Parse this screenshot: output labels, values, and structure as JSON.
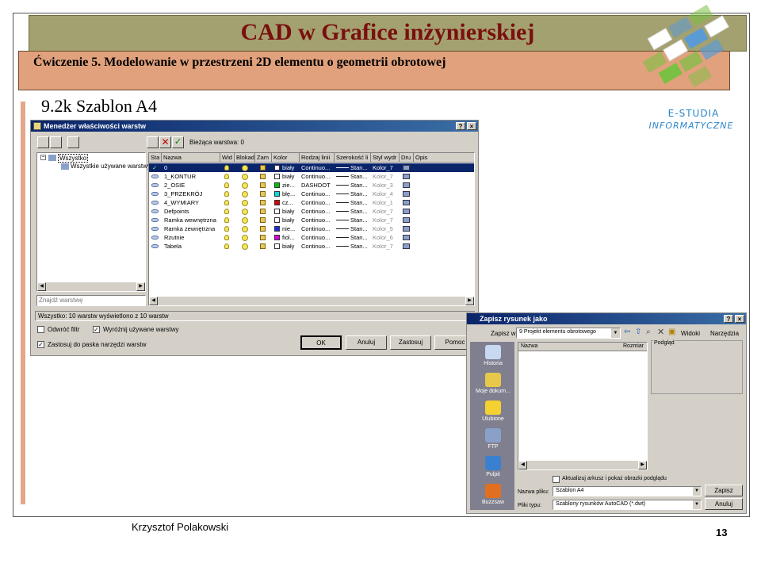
{
  "slide": {
    "title": "CAD w Grafice inżynierskiej",
    "subtitle": "Ćwiczenie 5. Modelowanie w przestrzeni 2D elementu o geometrii obrotowej",
    "section": "9.2k Szablon A4",
    "author": "Krzysztof Polakowski",
    "page_number": "13",
    "logo": {
      "line1": "E-STUDIA",
      "line2": "INFORMATYCZNE",
      "colors": [
        "#5b9bd5",
        "#7ac143",
        "#ffffff"
      ]
    },
    "colors": {
      "title_band": "#a3a16f",
      "subtitle_band": "#e0a17c",
      "title_text": "#7a0f0f",
      "accent_bar": "#e3a78a"
    }
  },
  "layer_manager": {
    "title": "Menedżer właściwości warstw",
    "help_btn": "?",
    "close_btn": "×",
    "current_layer": "Bieżąca warstwa: 0",
    "tree": {
      "root": "Wszystko",
      "child": "Wszystkie używane warstwy"
    },
    "search_placeholder": "Znajdź warstwę",
    "columns": [
      "Sta",
      "Nazwa",
      "Wid",
      "Blokad",
      "Zam",
      "Kolor",
      "Rodzaj linii",
      "Szerokość li",
      "Styl wydr",
      "Dru",
      "Opis"
    ],
    "rows": [
      {
        "name": "0",
        "color_name": "biały",
        "color": "#ffffff",
        "linetype": "Continuo...",
        "lineweight": "Stan...",
        "plotstyle": "Kolor_7",
        "selected": true
      },
      {
        "name": "1_KONTUR",
        "color_name": "biały",
        "color": "#ffffff",
        "linetype": "Continuo...",
        "lineweight": "Stan...",
        "plotstyle": "Kolor_7"
      },
      {
        "name": "2_OSIE",
        "color_name": "zie...",
        "color": "#00c000",
        "linetype": "DASHDOT",
        "lineweight": "Stan...",
        "plotstyle": "Kolor_3"
      },
      {
        "name": "3_PRZEKRÓJ",
        "color_name": "błę...",
        "color": "#00e0e0",
        "linetype": "Continuo...",
        "lineweight": "Stan...",
        "plotstyle": "Kolor_4"
      },
      {
        "name": "4_WYMIARY",
        "color_name": "cz...",
        "color": "#e00000",
        "linetype": "Continuo...",
        "lineweight": "Stan...",
        "plotstyle": "Kolor_1"
      },
      {
        "name": "Defpoints",
        "color_name": "biały",
        "color": "#ffffff",
        "linetype": "Continuo...",
        "lineweight": "Stan...",
        "plotstyle": "Kolor_7"
      },
      {
        "name": "Ramka wewnętrzna",
        "color_name": "biały",
        "color": "#ffffff",
        "linetype": "Continuo...",
        "lineweight": "Stan...",
        "plotstyle": "Kolor_7"
      },
      {
        "name": "Ramka zewnętrzna",
        "color_name": "nie...",
        "color": "#1030e0",
        "linetype": "Continuo...",
        "lineweight": "Stan...",
        "plotstyle": "Kolor_5"
      },
      {
        "name": "Rzutnie",
        "color_name": "fiol...",
        "color": "#e000e0",
        "linetype": "Continuo...",
        "lineweight": "Stan...",
        "plotstyle": "Kolor_6"
      },
      {
        "name": "Tabela",
        "color_name": "biały",
        "color": "#ffffff",
        "linetype": "Continuo...",
        "lineweight": "Stan...",
        "plotstyle": "Kolor_7"
      }
    ],
    "status": "Wszystko: 10 warstw wyświetlono z 10 warstw",
    "invert_filter": "Odwróć filtr",
    "highlight_used": "Wyróżnij używane warstwy",
    "apply_toolbar": "Zastosuj do paska narzędzi warstw",
    "buttons": {
      "ok": "OK",
      "cancel": "Anuluj",
      "apply": "Zastosuj",
      "help": "Pomoc"
    }
  },
  "save_dialog": {
    "title": "Zapisz rysunek jako",
    "help_btn": "?",
    "close_btn": "×",
    "save_in_label": "Zapisz w:",
    "save_in_value": "9 Projekt elementu obrotowego",
    "views_label": "Widoki",
    "tools_label": "Narzędzia",
    "col_name": "Nazwa",
    "col_size": "Rozmiar",
    "preview_label": "Podgląd",
    "places": [
      "Historia",
      "Moje dokum...",
      "Ulubione",
      "FTP",
      "Pulpit",
      "Buzzsaw"
    ],
    "update_sheets": "Aktualizuj arkusz i pokaż obrazki podglądu",
    "filename_label": "Nazwa pliku:",
    "filename_value": "Szablon A4",
    "filetype_label": "Pliki typu:",
    "filetype_value": "Szablony rysunków AutoCAD (*.dwt)",
    "buttons": {
      "save": "Zapisz",
      "cancel": "Anuluj"
    }
  }
}
